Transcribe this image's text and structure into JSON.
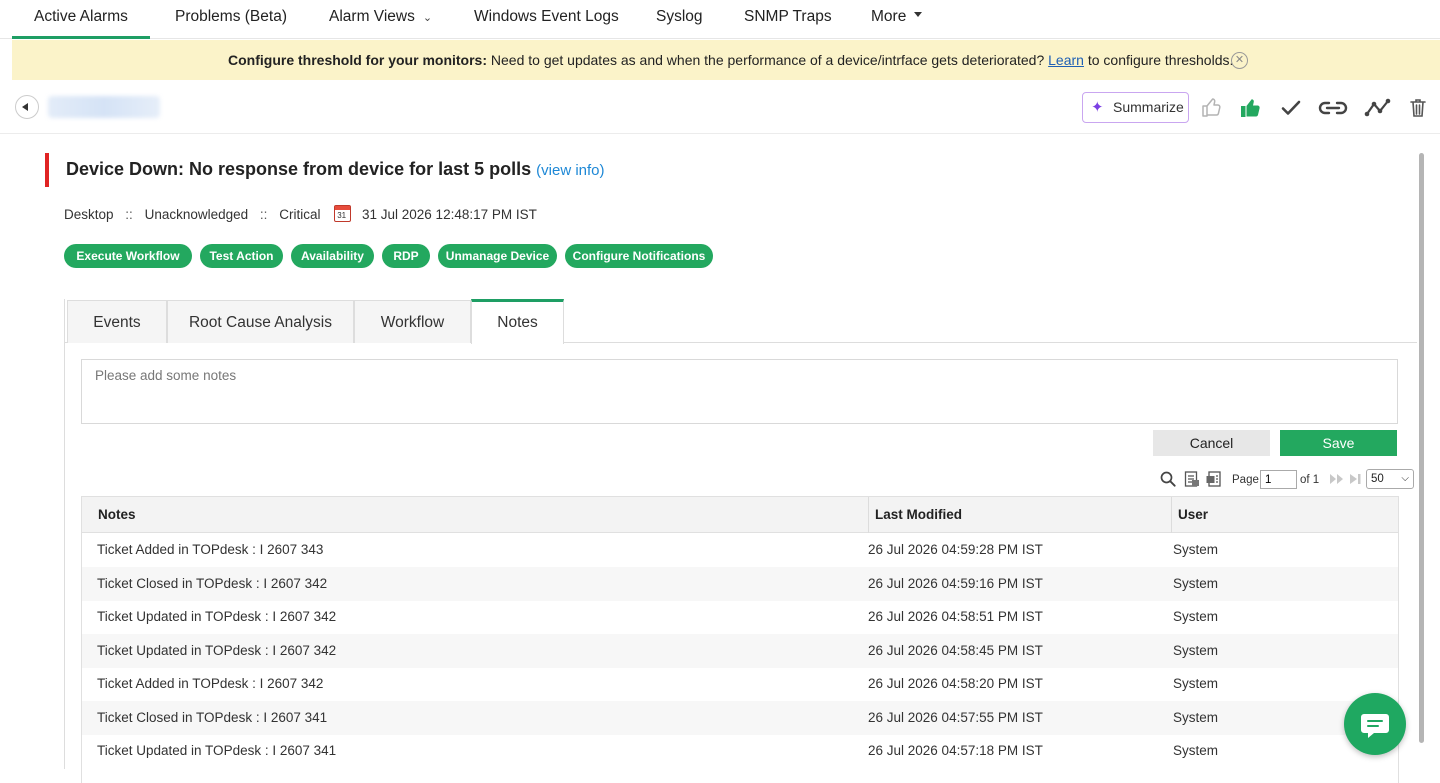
{
  "nav": {
    "items": [
      "Active Alarms",
      "Problems (Beta)",
      "Alarm Views",
      "Windows Event Logs",
      "Syslog",
      "SNMP Traps",
      "More"
    ]
  },
  "banner": {
    "bold": "Configure threshold for your monitors:",
    "text_before": "Need to get updates as and when the performance of a device/intrface gets deteriorated?",
    "link": "Learn",
    "text_after": "to configure thresholds."
  },
  "toolbar": {
    "summarize_label": "Summarize"
  },
  "alarm": {
    "title": "Device Down: No response from device for last 5 polls",
    "view_info": "(view info)",
    "category": "Desktop",
    "status": "Unacknowledged",
    "severity": "Critical",
    "separator": "::",
    "calendar_day": "31",
    "timestamp": "31 Jul 2026 12:48:17 PM IST",
    "severity_color": "#e02424"
  },
  "actions": [
    "Execute Workflow",
    "Test Action",
    "Availability",
    "RDP",
    "Unmanage Device",
    "Configure Notifications"
  ],
  "tabs": {
    "items": [
      "Events",
      "Root Cause Analysis",
      "Workflow",
      "Notes"
    ],
    "active": "Notes"
  },
  "notes_form": {
    "placeholder": "Please add some notes",
    "cancel_label": "Cancel",
    "save_label": "Save"
  },
  "pager": {
    "page_label": "Page",
    "page_value": "1",
    "of_label": "of 1",
    "page_size": "50"
  },
  "grid": {
    "columns": [
      "Notes",
      "Last Modified",
      "User"
    ],
    "rows": [
      {
        "note": "Ticket Added in TOPdesk : I 2607 343",
        "modified": "26 Jul 2026 04:59:28 PM IST",
        "user": "System"
      },
      {
        "note": "Ticket Closed in TOPdesk : I 2607 342",
        "modified": "26 Jul 2026 04:59:16 PM IST",
        "user": "System"
      },
      {
        "note": "Ticket Updated in TOPdesk : I 2607 342",
        "modified": "26 Jul 2026 04:58:51 PM IST",
        "user": "System"
      },
      {
        "note": "Ticket Updated in TOPdesk : I 2607 342",
        "modified": "26 Jul 2026 04:58:45 PM IST",
        "user": "System"
      },
      {
        "note": "Ticket Added in TOPdesk : I 2607 342",
        "modified": "26 Jul 2026 04:58:20 PM IST",
        "user": "System"
      },
      {
        "note": "Ticket Closed in TOPdesk : I 2607 341",
        "modified": "26 Jul 2026 04:57:55 PM IST",
        "user": "System"
      },
      {
        "note": "Ticket Updated in TOPdesk : I 2607 341",
        "modified": "26 Jul 2026 04:57:18 PM IST",
        "user": "System"
      }
    ]
  },
  "colors": {
    "accent_green": "#23a85f",
    "banner_bg": "#fbf3c9",
    "link_blue": "#1e88d6"
  },
  "icons": {
    "toolbar": [
      "thumbs-up-outline-icon",
      "thumbs-up-filled-icon",
      "checkmark-icon",
      "link-icon",
      "graph-icon",
      "trash-icon"
    ],
    "pager": [
      "search-icon",
      "export-pdf-icon",
      "export-csv-icon",
      "next-page-icon",
      "last-page-icon"
    ],
    "chat": "chat-icon"
  }
}
